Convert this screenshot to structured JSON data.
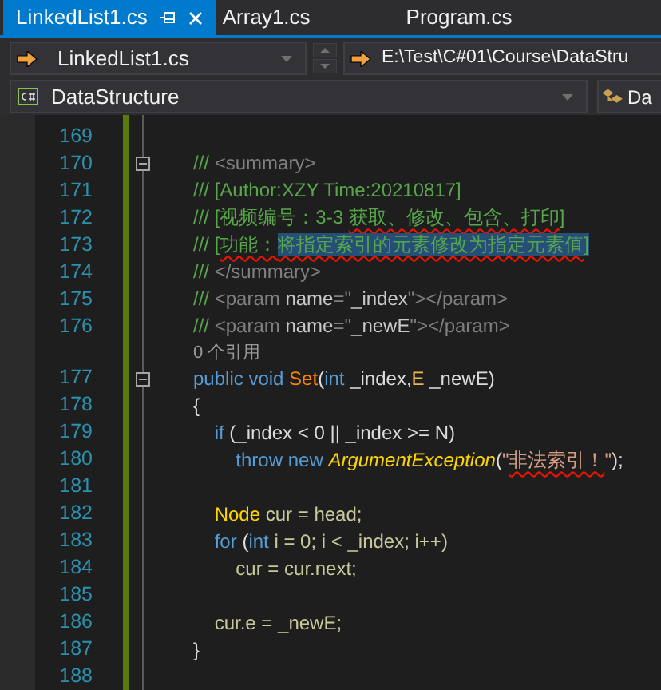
{
  "tabs": [
    {
      "label": "LinkedList1.cs",
      "selected": true,
      "pinned": true
    },
    {
      "label": "Array1.cs",
      "selected": false,
      "pinned": false
    },
    {
      "label": "Program.cs",
      "selected": false,
      "pinned": false
    }
  ],
  "navigation": {
    "file": "LinkedList1.cs",
    "path": "E:\\Test\\C#01\\Course\\DataStru",
    "project": "DataStructure",
    "member": "Da"
  },
  "lines": [
    {
      "kind": "code",
      "number": "169"
    },
    {
      "kind": "code",
      "number": "170",
      "fold": true,
      "tokens": [
        {
          "kind": "comment",
          "text": "/// "
        },
        {
          "kind": "doctag",
          "text": "<summary>"
        }
      ]
    },
    {
      "kind": "code",
      "number": "171",
      "tokens": [
        {
          "kind": "comment",
          "text": "/// [Author:XZY Time:20210817]"
        }
      ]
    },
    {
      "kind": "code",
      "number": "172",
      "tokens": [
        {
          "kind": "comment",
          "text": "/// [视频编号：3-3 "
        },
        {
          "kind": "comment",
          "text": "获取、修改、包含、打印",
          "squiggle": true
        },
        {
          "kind": "comment",
          "text": "]"
        }
      ]
    },
    {
      "kind": "code",
      "number": "173",
      "tokens": [
        {
          "kind": "comment",
          "text": "/// ["
        },
        {
          "kind": "comment",
          "text": "功能：",
          "squiggle": true
        },
        {
          "kind": "comment",
          "text": "将指定索引的元素修改为指定元素值",
          "squiggle": true,
          "selected": true
        },
        {
          "kind": "comment",
          "text": "]",
          "selected": true
        }
      ]
    },
    {
      "kind": "code",
      "number": "174",
      "tokens": [
        {
          "kind": "comment",
          "text": "/// "
        },
        {
          "kind": "doctag",
          "text": "</summary>"
        }
      ]
    },
    {
      "kind": "code",
      "number": "175",
      "tokens": [
        {
          "kind": "comment",
          "text": "/// "
        },
        {
          "kind": "doctag",
          "text": "<param "
        },
        {
          "kind": "docattr",
          "text": "name"
        },
        {
          "kind": "doctag",
          "text": "=\""
        },
        {
          "kind": "docattr",
          "text": "_index"
        },
        {
          "kind": "doctag",
          "text": "\"></param>"
        }
      ]
    },
    {
      "kind": "code",
      "number": "176",
      "tokens": [
        {
          "kind": "comment",
          "text": "/// "
        },
        {
          "kind": "doctag",
          "text": "<param "
        },
        {
          "kind": "docattr",
          "text": "name"
        },
        {
          "kind": "doctag",
          "text": "=\""
        },
        {
          "kind": "docattr",
          "text": "_newE"
        },
        {
          "kind": "doctag",
          "text": "\"></param>"
        }
      ]
    },
    {
      "kind": "codelens",
      "text": "0 个引用"
    },
    {
      "kind": "code",
      "number": "177",
      "fold": true,
      "tokens": [
        {
          "kind": "keyword",
          "text": "public void "
        },
        {
          "kind": "method",
          "text": "Set"
        },
        {
          "kind": "plain",
          "text": "("
        },
        {
          "kind": "keyword",
          "text": "int "
        },
        {
          "kind": "plain",
          "text": "_index,"
        },
        {
          "kind": "typeparam",
          "text": "E"
        },
        {
          "kind": "plain",
          "text": " _newE)"
        }
      ]
    },
    {
      "kind": "code",
      "number": "178",
      "tokens": [
        {
          "kind": "plain",
          "text": "{"
        }
      ]
    },
    {
      "kind": "code",
      "number": "179",
      "tokens": [
        {
          "kind": "keyword",
          "text": "    if "
        },
        {
          "kind": "plain",
          "text": "(_index < 0 || _index >= N)"
        }
      ]
    },
    {
      "kind": "code",
      "number": "180",
      "tokens": [
        {
          "kind": "keyword",
          "text": "        throw new "
        },
        {
          "kind": "type",
          "text": "ArgumentException"
        },
        {
          "kind": "plain",
          "text": "("
        },
        {
          "kind": "string",
          "text": "\""
        },
        {
          "kind": "string",
          "text": "非法索引！",
          "squiggle": true
        },
        {
          "kind": "string",
          "text": "\""
        },
        {
          "kind": "plain",
          "text": ");"
        }
      ]
    },
    {
      "kind": "code",
      "number": "181"
    },
    {
      "kind": "code",
      "number": "182",
      "tokens": [
        {
          "kind": "class",
          "text": "    Node "
        },
        {
          "kind": "variable",
          "text": "cur = head;"
        }
      ]
    },
    {
      "kind": "code",
      "number": "183",
      "tokens": [
        {
          "kind": "keyword",
          "text": "    for "
        },
        {
          "kind": "plain",
          "text": "("
        },
        {
          "kind": "keyword",
          "text": "int "
        },
        {
          "kind": "variable",
          "text": "i = 0; i < _index; i++)"
        }
      ]
    },
    {
      "kind": "code",
      "number": "184",
      "tokens": [
        {
          "kind": "variable",
          "text": "        cur = cur.next;"
        }
      ]
    },
    {
      "kind": "code",
      "number": "185"
    },
    {
      "kind": "code",
      "number": "186",
      "tokens": [
        {
          "kind": "variable",
          "text": "    cur.e = _newE;"
        }
      ]
    },
    {
      "kind": "code",
      "number": "187",
      "tokens": [
        {
          "kind": "plain",
          "text": "}"
        }
      ]
    },
    {
      "kind": "code",
      "number": "188"
    }
  ]
}
